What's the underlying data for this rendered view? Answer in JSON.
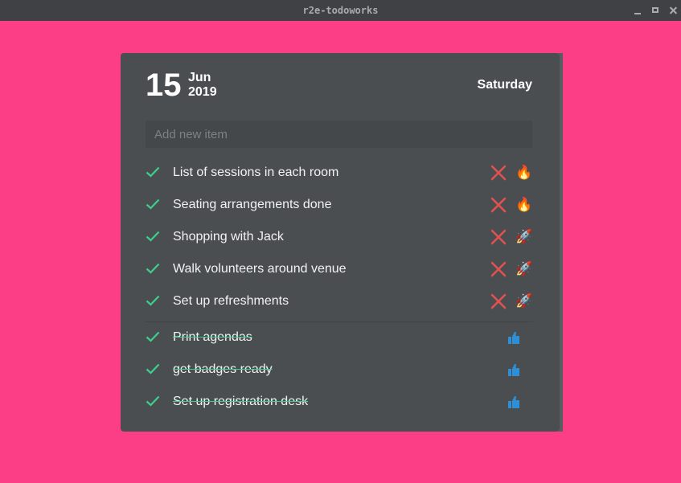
{
  "window": {
    "title": "r2e-todoworks"
  },
  "date": {
    "day": "15",
    "month": "Jun",
    "year": "2019",
    "weekday": "Saturday"
  },
  "input": {
    "placeholder": "Add new item"
  },
  "colors": {
    "background": "#fb3e86",
    "card": "#4b4e51",
    "check": "#3ecf8e",
    "delete": "#e0514f",
    "thumb": "#2e8fd6"
  },
  "todos": [
    {
      "text": "List of sessions in each room",
      "priority_icon": "fire-icon",
      "glyph": "🔥"
    },
    {
      "text": "Seating arrangements done",
      "priority_icon": "fire-icon",
      "glyph": "🔥"
    },
    {
      "text": "Shopping with Jack",
      "priority_icon": "rocket-icon",
      "glyph": "🚀"
    },
    {
      "text": "Walk volunteers around venue",
      "priority_icon": "rocket-icon",
      "glyph": "🚀"
    },
    {
      "text": "Set up refreshments",
      "priority_icon": "rocket-icon",
      "glyph": "🚀"
    }
  ],
  "completed": [
    {
      "text": "Print agendas"
    },
    {
      "text": "get badges ready"
    },
    {
      "text": "Set up registration desk"
    }
  ]
}
